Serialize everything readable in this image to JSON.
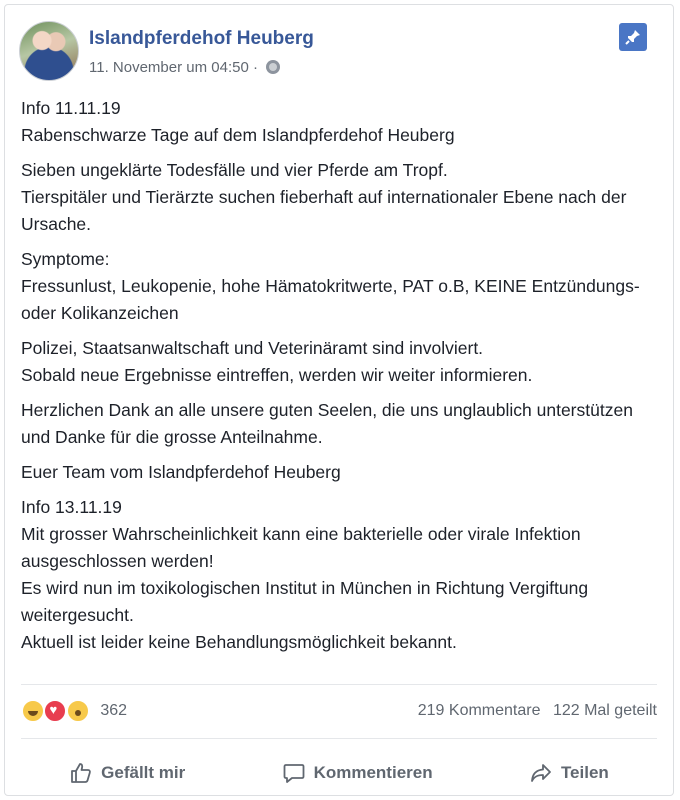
{
  "post": {
    "page_name": "Islandpferdehof Heuberg",
    "timestamp": "11. November um 04:50 ·",
    "privacy_icon": "globe-icon",
    "pinned_icon": "pin-icon",
    "paragraphs": [
      "Info 11.11.19\nRabenschwarze Tage auf dem Islandpferdehof Heuberg",
      "Sieben ungeklärte Todesfälle und vier Pferde am Tropf.\nTierspitäler und Tierärzte suchen fieberhaft auf internationaler Ebene nach der Ursache.",
      "Symptome:\nFressunlust, Leukopenie, hohe Hämatokritwerte, PAT o.B, KEINE Entzündungs- oder Kolikanzeichen",
      "Polizei, Staatsanwaltschaft und Veterinäramt sind involviert.\nSobald neue Ergebnisse eintreffen, werden wir weiter informieren.",
      "Herzlichen Dank an alle unsere guten Seelen, die uns unglaublich unterstützen und Danke für die grosse Anteilnahme.",
      "Euer Team vom Islandpferdehof Heuberg",
      "Info 13.11.19\nMit grosser Wahrscheinlichkeit kann eine bakterielle oder virale Infektion ausgeschlossen werden!\nEs wird nun im toxikologischen Institut in München in Richtung Vergiftung weitergesucht.\nAktuell ist leider keine Behandlungsmöglichkeit bekannt."
    ]
  },
  "engagement": {
    "reaction_count": "362",
    "comments": "219 Kommentare",
    "shares": "122 Mal geteilt"
  },
  "actions": {
    "like": "Gefällt mir",
    "comment": "Kommentieren",
    "share": "Teilen"
  }
}
